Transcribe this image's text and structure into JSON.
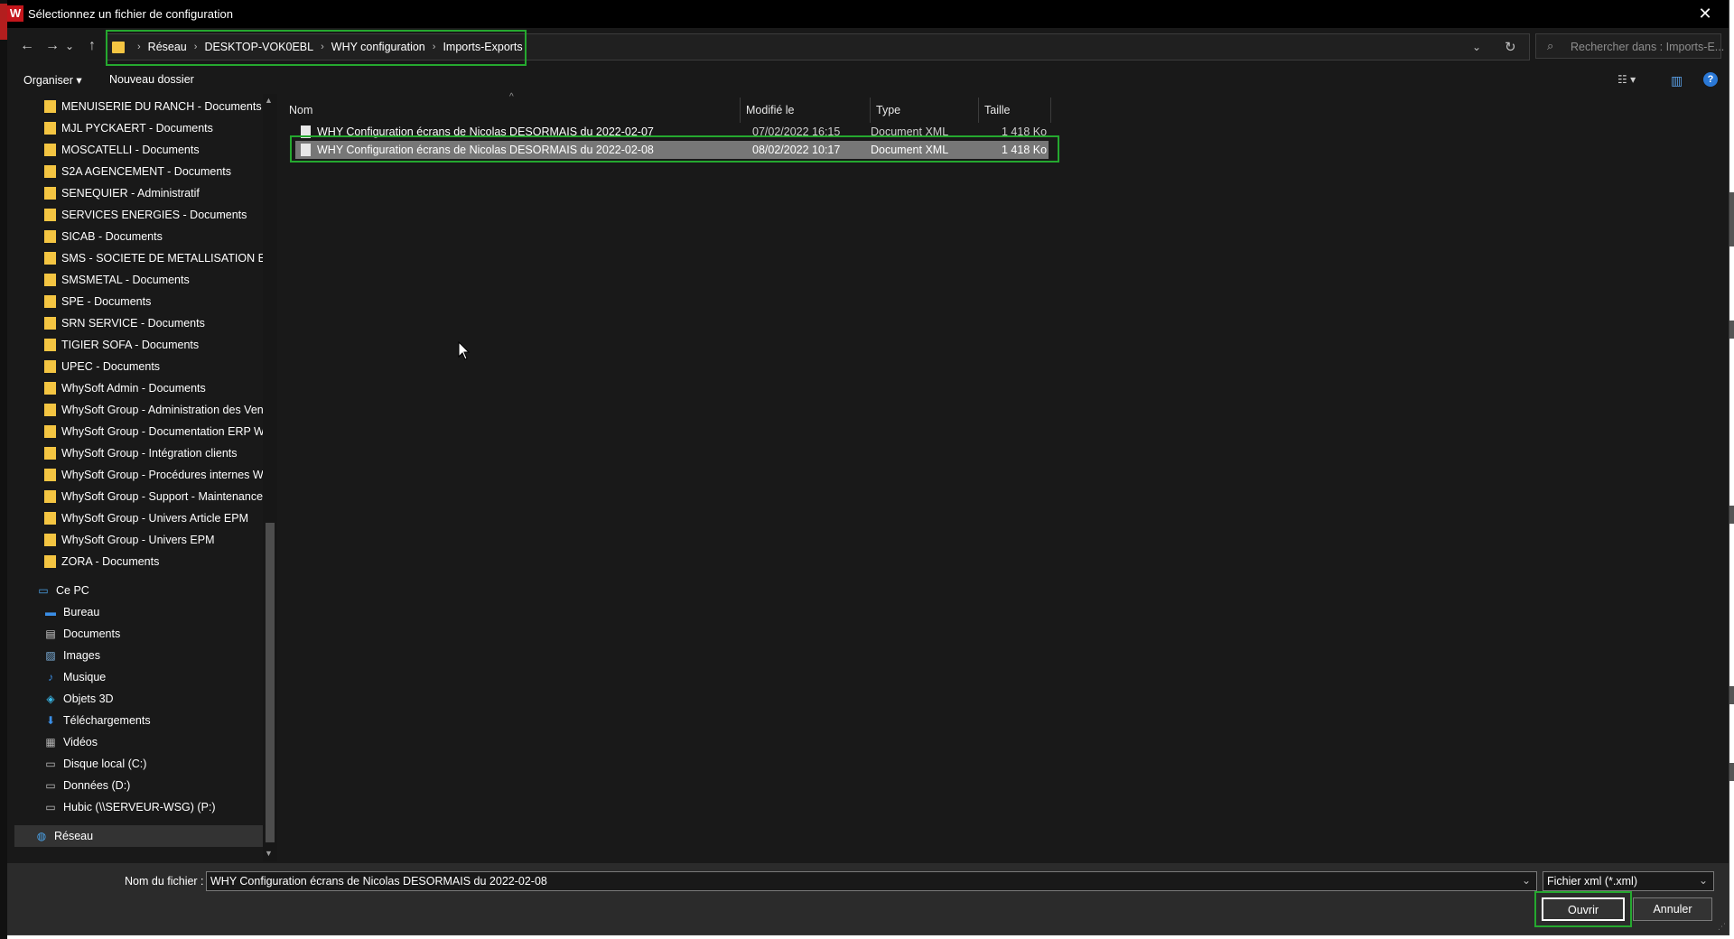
{
  "window": {
    "app_icon_letter": "W",
    "title": "Sélectionnez un fichier de configuration",
    "close_glyph": "✕"
  },
  "nav": {
    "back_glyph": "←",
    "forward_glyph": "→",
    "recent_glyph": "⌄",
    "up_glyph": "↑",
    "breadcrumbs": [
      "Réseau",
      "DESKTOP-VOK0EBL",
      "WHY configuration",
      "Imports-Exports"
    ],
    "separator": "›",
    "dropdown_glyph": "⌄",
    "refresh_glyph": "↻",
    "search_placeholder": "Rechercher dans : Imports-E...",
    "search_glyph": "⌕"
  },
  "toolbar": {
    "organize_label": "Organiser ▾",
    "new_folder_label": "Nouveau dossier",
    "view_glyph": "☷ ▾",
    "pane_glyph": "▥",
    "help_glyph": "?"
  },
  "sidebar": {
    "folders": [
      "MENUISERIE DU RANCH - Documents",
      "MJL PYCKAERT - Documents",
      "MOSCATELLI - Documents",
      "S2A AGENCEMENT - Documents",
      "SENEQUIER - Administratif",
      "SERVICES ENERGIES - Documents",
      "SICAB - Documents",
      "SMS - SOCIETE DE METALLISATION ET DE S",
      "SMSMETAL - Documents",
      "SPE - Documents",
      "SRN SERVICE - Documents",
      "TIGIER SOFA - Documents",
      "UPEC - Documents",
      "WhySoft Admin - Documents",
      "WhySoft Group - Administration des Vente",
      "WhySoft Group - Documentation ERP WHY",
      "WhySoft Group - Intégration clients",
      "WhySoft Group - Procédures internes WSG",
      "WhySoft Group - Support - Maintenance",
      "WhySoft Group - Univers Article EPM",
      "WhySoft Group - Univers EPM",
      "ZORA - Documents"
    ],
    "this_pc": "Ce PC",
    "pc_items": [
      {
        "label": "Bureau",
        "icon": "▬",
        "color": "#3a8ee6"
      },
      {
        "label": "Documents",
        "icon": "▤",
        "color": "#d0d0d0"
      },
      {
        "label": "Images",
        "icon": "▨",
        "color": "#7fb3e0"
      },
      {
        "label": "Musique",
        "icon": "♪",
        "color": "#3a8ee6"
      },
      {
        "label": "Objets 3D",
        "icon": "◈",
        "color": "#39b8e8"
      },
      {
        "label": "Téléchargements",
        "icon": "⬇",
        "color": "#3a8ee6"
      },
      {
        "label": "Vidéos",
        "icon": "▦",
        "color": "#b0b0b0"
      },
      {
        "label": "Disque local (C:)",
        "icon": "▭",
        "color": "#c0c0c0"
      },
      {
        "label": "Données (D:)",
        "icon": "▭",
        "color": "#c0c0c0"
      },
      {
        "label": "Hubic (\\\\SERVEUR-WSG) (P:)",
        "icon": "▭",
        "color": "#c0c0c0"
      }
    ],
    "network": "Réseau"
  },
  "files": {
    "columns": [
      "Nom",
      "Modifié le",
      "Type",
      "Taille"
    ],
    "rows": [
      {
        "name": "WHY Configuration écrans de Nicolas DESORMAIS du 2022-02-07",
        "modified": "07/02/2022 16:15",
        "type": "Document XML",
        "size": "1 418 Ko",
        "selected": false
      },
      {
        "name": "WHY Configuration écrans de Nicolas DESORMAIS du 2022-02-08",
        "modified": "08/02/2022 10:17",
        "type": "Document XML",
        "size": "1 418 Ko",
        "selected": true
      }
    ]
  },
  "footer": {
    "filename_label": "Nom du fichier :",
    "filename_value": "WHY Configuration écrans de Nicolas DESORMAIS du 2022-02-08",
    "filter_value": "Fichier xml (*.xml)",
    "open_label": "Ouvrir",
    "cancel_label": "Annuler"
  },
  "colors": {
    "highlight": "#25a82f",
    "folder": "#f4c542",
    "accent": "#2a78d6"
  }
}
